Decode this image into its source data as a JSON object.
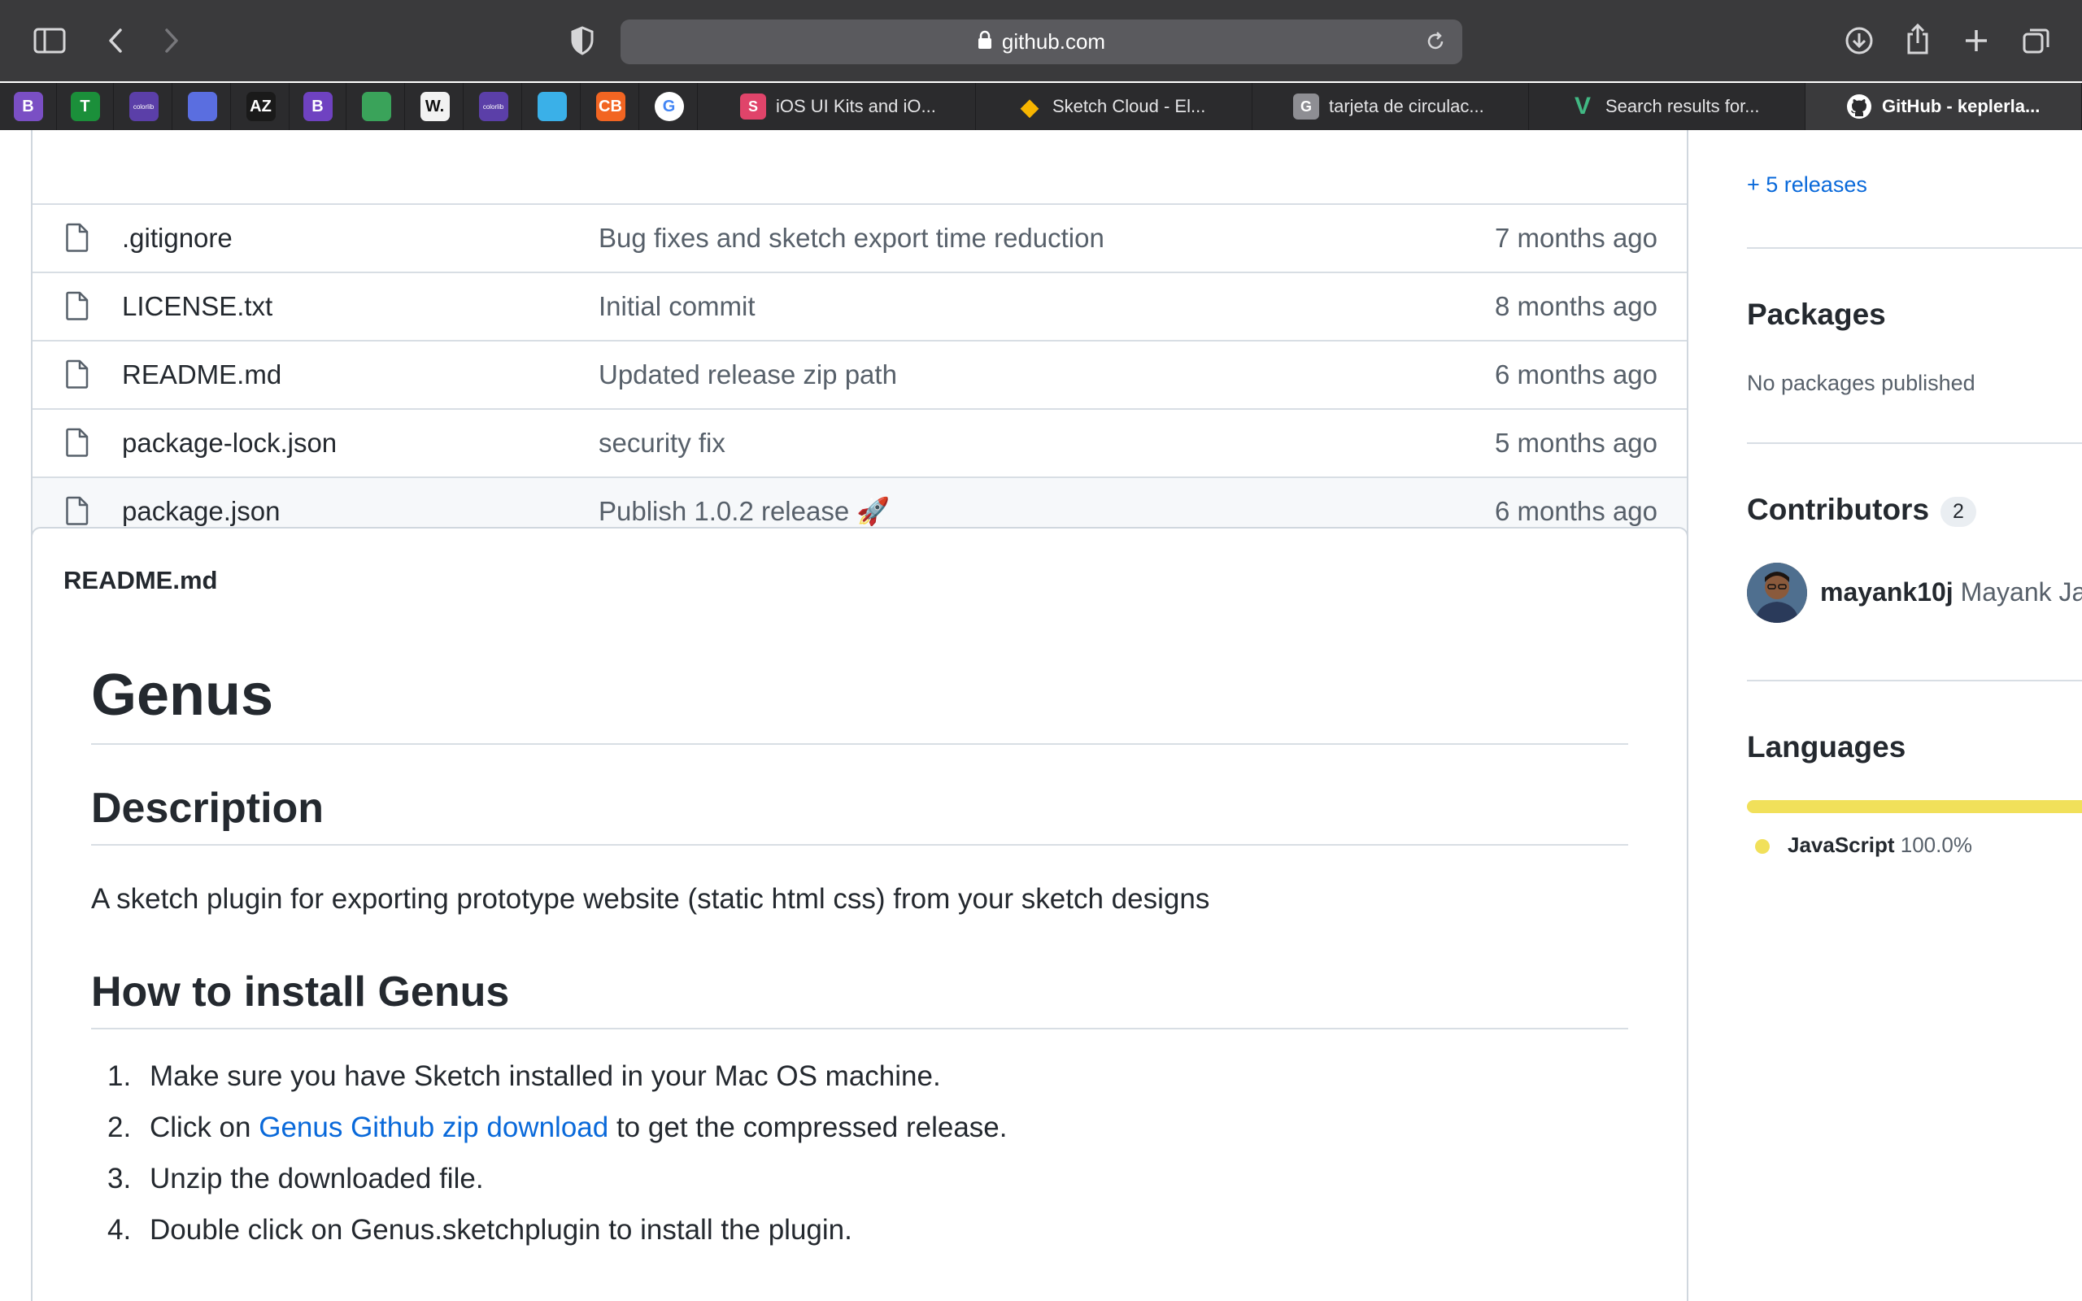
{
  "browser": {
    "url": "github.com",
    "pinned_tabs": [
      {
        "icon": "bootstrap-icon",
        "letter": "B",
        "color": "#7a4fc4"
      },
      {
        "icon": "typora-icon",
        "letter": "T",
        "color": "#1b8f3a"
      },
      {
        "icon": "colorlib-icon",
        "letter": "colorlib",
        "color": "#5b3fa8"
      },
      {
        "icon": "mask-icon",
        "letter": "",
        "color": "#5a6ee0"
      },
      {
        "icon": "az-icon",
        "letter": "AZ",
        "color": "#1a1a1a"
      },
      {
        "icon": "bootstrap-purple-icon",
        "letter": "B",
        "color": "#6f42c1"
      },
      {
        "icon": "leaf-icon",
        "letter": "",
        "color": "#3aa35a"
      },
      {
        "icon": "w-icon",
        "letter": "W.",
        "color": "#f2f2f2"
      },
      {
        "icon": "colorlib-icon-2",
        "letter": "colorlib",
        "color": "#5b3fa8"
      },
      {
        "icon": "gradient-icon",
        "letter": "",
        "color": "#3ab0e8"
      },
      {
        "icon": "cb-icon",
        "letter": "CB",
        "color": "#f26522"
      },
      {
        "icon": "google-icon",
        "letter": "G",
        "color": "#ffffff"
      }
    ],
    "tabs": [
      {
        "label": "iOS UI Kits and iO...",
        "icon": "sketch-s-icon",
        "color": "#e0446a",
        "glyph": "S"
      },
      {
        "label": "Sketch Cloud - El...",
        "icon": "sketch-diamond-icon",
        "color": "#f7b500",
        "glyph": "◆"
      },
      {
        "label": "tarjeta de circulac...",
        "icon": "g-letter-icon",
        "color": "#8e8e93",
        "glyph": "G"
      },
      {
        "label": "Search results for...",
        "icon": "vuetify-icon",
        "color": "#41b883",
        "glyph": "V"
      },
      {
        "label": "GitHub - keplerla...",
        "icon": "github-icon",
        "color": "#ffffff",
        "glyph": ""
      }
    ]
  },
  "files": [
    {
      "name": ".gitignore",
      "message": "Bug fixes and sketch export time reduction",
      "age": "7 months ago"
    },
    {
      "name": "LICENSE.txt",
      "message": "Initial commit",
      "age": "8 months ago"
    },
    {
      "name": "README.md",
      "message": "Updated release zip path",
      "age": "6 months ago"
    },
    {
      "name": "package-lock.json",
      "message": "security fix",
      "age": "5 months ago"
    },
    {
      "name": "package.json",
      "message": "Publish 1.0.2 release 🚀",
      "age": "6 months ago"
    }
  ],
  "readme": {
    "file_title": "README.md",
    "h1": "Genus",
    "h2_description": "Description",
    "description": "A sketch plugin for exporting prototype website (static html css) from your sketch designs",
    "h2_install": "How to install Genus",
    "steps": [
      {
        "num": "1.",
        "text": "Make sure you have Sketch installed in your Mac OS machine."
      },
      {
        "num": "2.",
        "pre": "Click on ",
        "link": "Genus Github zip download",
        "post": " to get the compressed release."
      },
      {
        "num": "3.",
        "text": "Unzip the downloaded file."
      },
      {
        "num": "4.",
        "text": "Double click on Genus.sketchplugin to install the plugin."
      }
    ]
  },
  "sidebar": {
    "releases_link": "+ 5 releases",
    "packages_title": "Packages",
    "packages_text": "No packages published",
    "contributors_title": "Contributors",
    "contributors_count": "2",
    "contributor_login": "mayank10j",
    "contributor_name": "Mayank Ja",
    "languages_title": "Languages",
    "language_name": "JavaScript",
    "language_percent": "100.0%",
    "language_share": 1.0,
    "language_color": "#f1e05a"
  }
}
